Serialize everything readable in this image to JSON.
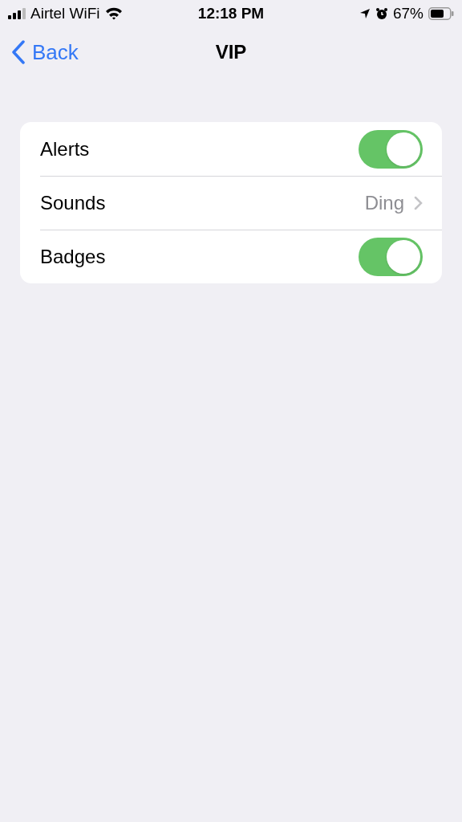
{
  "status_bar": {
    "carrier": "Airtel WiFi",
    "time": "12:18 PM",
    "battery": "67%"
  },
  "nav_bar": {
    "back": "Back",
    "title": "VIP"
  },
  "settings": [
    {
      "kind": "toggle",
      "label": "Alerts",
      "on": true
    },
    {
      "kind": "link",
      "label": "Sounds",
      "value": "Ding"
    },
    {
      "kind": "toggle",
      "label": "Badges",
      "on": true
    }
  ]
}
